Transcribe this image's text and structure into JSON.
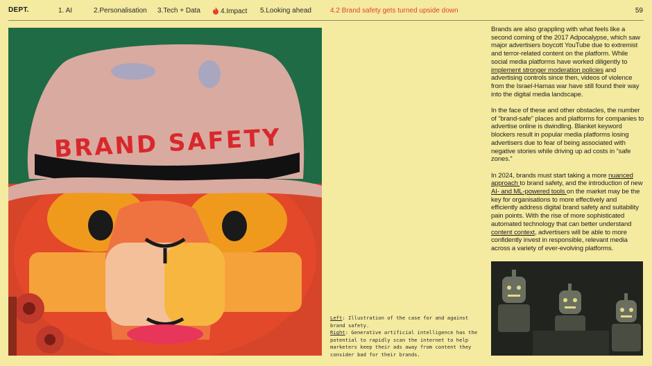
{
  "header": {
    "brand": "DEPT.",
    "nav": [
      "1. AI",
      "2.Personalisation",
      "3.Tech + Data",
      "4.Impact",
      "5.Looking ahead"
    ],
    "active_section": "4.2 Brand safety gets turned upside down",
    "page_number": "59"
  },
  "illustration": {
    "hat_text": "BRAND SAFETY"
  },
  "caption": {
    "left_label": "Left",
    "left_text": ": Illustration of the case for and against brand safety.",
    "right_label": "Right",
    "right_text": ": Generative artificial intelligence has the potential to rapidly scan the internet to help marketers keep their ads away from content they consider bad for their brands."
  },
  "body": {
    "p1_a": "Brands are also grappling with what feels like a second coming of the 2017 Adpocalypse, which saw major advertisers boycott YouTube due to extremist and terror-related content on the platform. While social media platforms have worked diligently to ",
    "p1_link": "implement stronger moderation policies",
    "p1_b": " and advertising controls since then, videos of violence from the Israel-Hamas war have still found their way into the digital media landscape.",
    "p2": "In the face of these and other obstacles, the number of “brand-safe” places and platforms for companies to advertise online is dwindling. Blanket keyword blockers result in popular media platforms losing advertisers due to fear of being associated with negative stories while driving up ad costs in “safe zones.”",
    "p3_a": "In 2024, brands must start taking a more ",
    "p3_link1": "nuanced approach ",
    "p3_b": "to brand safety, and the introduction of new ",
    "p3_link2": "AI- and ML-powered tools ",
    "p3_c": "on the market may be the key for organisations to more effectively and efficiently address digital brand safety and suitability pain points. With the rise of more sophisticated automated technology that can better understand ",
    "p3_link3": "content context",
    "p3_d": ", advertisers will be able to more confidently invest in responsible, relevant media across a variety of ever-evolving platforms."
  },
  "colors": {
    "page_bg": "#f4eaa0",
    "accent": "#e0442d",
    "illus_green": "#1f6b45",
    "hat": "#d9aaa0",
    "hat_text": "#d8282c"
  }
}
